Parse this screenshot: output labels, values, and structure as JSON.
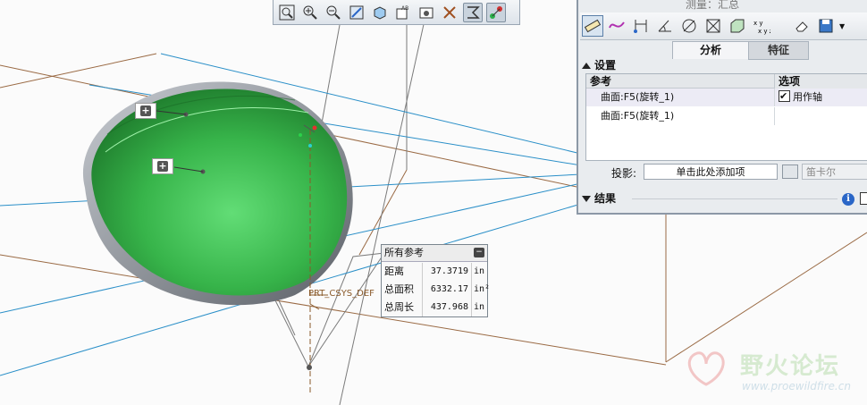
{
  "toolbar": {
    "icons": [
      "zoom-fit-icon",
      "zoom-in-icon",
      "zoom-out-icon",
      "repaint-icon",
      "display-style-icon",
      "saved-view-icon",
      "view-manager-icon",
      "datum-display-icon",
      "annotation-display-icon",
      "spin-center-icon"
    ]
  },
  "measure": {
    "title": "测量：汇总",
    "tabs": [
      "分析",
      "特征"
    ],
    "setup_label": "设置",
    "col_ref": "参考",
    "col_option": "选项",
    "rows": [
      {
        "ref": "曲面:F5(旋转_1)",
        "option": "用作轴",
        "checked": true
      },
      {
        "ref": "曲面:F5(旋转_1)",
        "option": ""
      }
    ],
    "projection_label": "投影:",
    "projection_value": "单击此处添加项",
    "coord_select": "笛卡尔",
    "results_label": "结果"
  },
  "result_box": {
    "title": "所有参考",
    "rows": [
      {
        "label": "距离",
        "value": "37.3719",
        "unit": "in"
      },
      {
        "label": "总面积",
        "value": "6332.17",
        "unit": "in²"
      },
      {
        "label": "总周长",
        "value": "437.968",
        "unit": "in"
      }
    ]
  },
  "csys_label": "PRT_CSYS_DEF",
  "watermark": {
    "text": "野火论坛",
    "url": "www.proewildfire.cn"
  },
  "colors": {
    "surface": "#3aa84a",
    "panel": "#e9ecef",
    "datum_blue": "#2a8fc8",
    "datum_brown": "#9a5a2a"
  }
}
